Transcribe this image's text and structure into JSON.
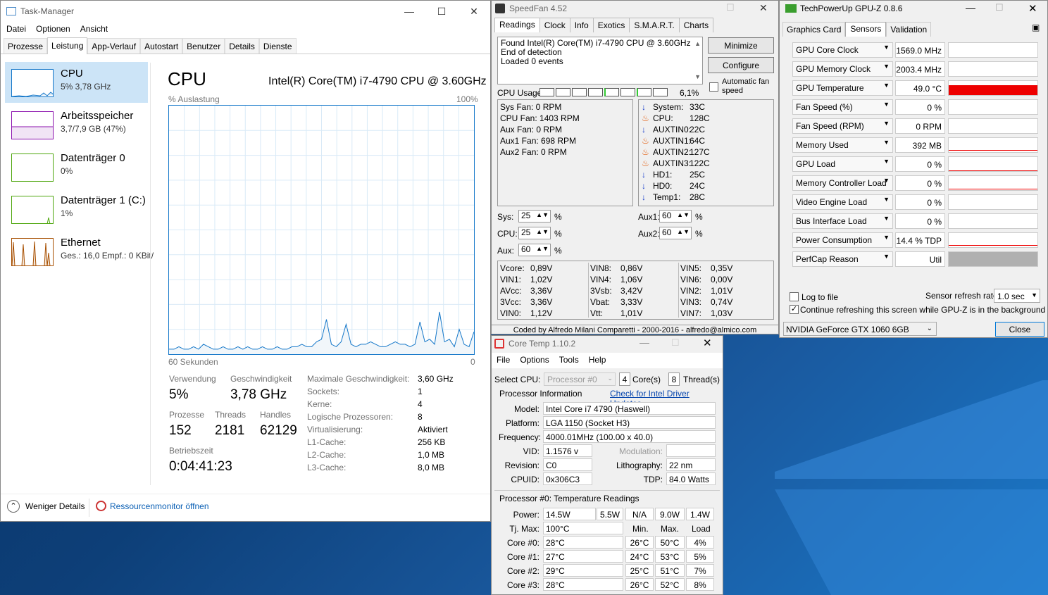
{
  "taskmanager": {
    "title": "Task-Manager",
    "menu": [
      "Datei",
      "Optionen",
      "Ansicht"
    ],
    "tabs": [
      "Prozesse",
      "Leistung",
      "App-Verlauf",
      "Autostart",
      "Benutzer",
      "Details",
      "Dienste"
    ],
    "active_tab": "Leistung",
    "side": [
      {
        "name": "CPU",
        "sub": "5% 3,78 GHz",
        "color": "#1477c9"
      },
      {
        "name": "Arbeitsspeicher",
        "sub": "3,7/7,9 GB (47%)",
        "color": "#8b12ae"
      },
      {
        "name": "Datenträger 0",
        "sub": "0%",
        "color": "#4da60c"
      },
      {
        "name": "Datenträger 1 (C:)",
        "sub": "1%",
        "color": "#4da60c"
      },
      {
        "name": "Ethernet",
        "sub": "Ges.: 16,0 Empf.: 0 KBit/",
        "color": "#a74f01"
      }
    ],
    "heading": "CPU",
    "model": "Intel(R) Core(TM) i7-4790 CPU @ 3.60GHz",
    "util_label": "% Auslastung",
    "util_max": "100%",
    "time_label": "60 Sekunden",
    "time_end": "0",
    "stats": {
      "verwendung_l": "Verwendung",
      "verwendung_v": "5%",
      "geschw_l": "Geschwindigkeit",
      "geschw_v": "3,78 GHz",
      "prozesse_l": "Prozesse",
      "prozesse_v": "152",
      "threads_l": "Threads",
      "threads_v": "2181",
      "handles_l": "Handles",
      "handles_v": "62129",
      "betrieb_l": "Betriebszeit",
      "betrieb_v": "0:04:41:23"
    },
    "details": [
      [
        "Maximale Geschwindigkeit:",
        "3,60 GHz"
      ],
      [
        "Sockets:",
        "1"
      ],
      [
        "Kerne:",
        "4"
      ],
      [
        "Logische Prozessoren:",
        "8"
      ],
      [
        "Virtualisierung:",
        "Aktiviert"
      ],
      [
        "L1-Cache:",
        "256 KB"
      ],
      [
        "L2-Cache:",
        "1,0 MB"
      ],
      [
        "L3-Cache:",
        "8,0 MB"
      ]
    ],
    "footer_less": "Weniger Details",
    "footer_monitor": "Ressourcenmonitor öffnen",
    "cpu_history": [
      2,
      2,
      3,
      2,
      2,
      3,
      2,
      4,
      3,
      2,
      2,
      3,
      2,
      2,
      3,
      2,
      3,
      2,
      2,
      3,
      2,
      2,
      3,
      2,
      2,
      3,
      3,
      4,
      3,
      3,
      5,
      6,
      14,
      4,
      3,
      5,
      12,
      4,
      3,
      4,
      4,
      5,
      4,
      3,
      3,
      4,
      5,
      4,
      4,
      3,
      4,
      13,
      5,
      6,
      4,
      17,
      5,
      6,
      3,
      10,
      4,
      3,
      9
    ]
  },
  "speedfan": {
    "title": "SpeedFan 4.52",
    "tabs": [
      "Readings",
      "Clock",
      "Info",
      "Exotics",
      "S.M.A.R.T.",
      "Charts"
    ],
    "log": [
      "Found Intel(R) Core(TM) i7-4790 CPU @ 3.60GHz",
      "End of detection",
      "Loaded 0 events"
    ],
    "minimize": "Minimize",
    "configure": "Configure",
    "auto_fan": "Automatic fan speed",
    "cpu_usage_label": "CPU Usage",
    "cpu_usage_val": "6,1%",
    "fans": [
      "Sys Fan:  0 RPM",
      "CPU Fan:  1403 RPM",
      "Aux Fan:  0 RPM",
      "Aux1 Fan: 698 RPM",
      "Aux2 Fan: 0 RPM"
    ],
    "temps": [
      {
        "n": "System:",
        "v": "33C",
        "hot": false
      },
      {
        "n": "CPU:",
        "v": "128C",
        "hot": true
      },
      {
        "n": "AUXTIN0:",
        "v": "22C",
        "hot": false
      },
      {
        "n": "AUXTIN1:",
        "v": "64C",
        "hot": true
      },
      {
        "n": "AUXTIN2:",
        "v": "127C",
        "hot": true
      },
      {
        "n": "AUXTIN3:",
        "v": "122C",
        "hot": true
      },
      {
        "n": "HD1:",
        "v": "25C",
        "hot": false
      },
      {
        "n": "HD0:",
        "v": "24C",
        "hot": false
      },
      {
        "n": "Temp1:",
        "v": "28C",
        "hot": false
      }
    ],
    "speeds": {
      "sys_l": "Sys:",
      "sys_v": "25",
      "cpu_l": "CPU:",
      "cpu_v": "25",
      "aux_l": "Aux:",
      "aux_v": "60",
      "aux1_l": "Aux1:",
      "aux1_v": "60",
      "aux2_l": "Aux2:",
      "aux2_v": "60",
      "pct": "%"
    },
    "volts": [
      [
        "Vcore:",
        "0,89V",
        "VIN8:",
        "0,86V",
        "VIN5:",
        "0,35V"
      ],
      [
        "VIN1:",
        "1,02V",
        "VIN4:",
        "1,06V",
        "VIN6:",
        "0,00V"
      ],
      [
        "AVcc:",
        "3,36V",
        "3Vsb:",
        "3,42V",
        "VIN2:",
        "1,01V"
      ],
      [
        "3Vcc:",
        "3,36V",
        "Vbat:",
        "3,33V",
        "VIN3:",
        "0,74V"
      ],
      [
        "VIN0:",
        "1,12V",
        "Vtt:",
        "1,01V",
        "VIN7:",
        "1,03V"
      ]
    ],
    "status": "Coded by Alfredo Milani Comparetti - 2000-2016 - alfredo@almico.com"
  },
  "gpuz": {
    "title": "TechPowerUp GPU-Z 0.8.6",
    "tabs": [
      "Graphics Card",
      "Sensors",
      "Validation"
    ],
    "sensors": [
      {
        "n": "GPU Core Clock",
        "v": "1569.0 MHz",
        "g": 0
      },
      {
        "n": "GPU Memory Clock",
        "v": "2003.4 MHz",
        "g": 0
      },
      {
        "n": "GPU Temperature",
        "v": "49.0 °C",
        "g": 0.7
      },
      {
        "n": "Fan Speed (%)",
        "v": "0 %",
        "g": 0
      },
      {
        "n": "Fan Speed (RPM)",
        "v": "0 RPM",
        "g": 0
      },
      {
        "n": "Memory Used",
        "v": "392 MB",
        "g": 0.1
      },
      {
        "n": "GPU Load",
        "v": "0 %",
        "g": 0.02
      },
      {
        "n": "Memory Controller Load",
        "v": "0 %",
        "g": 0.05
      },
      {
        "n": "Video Engine Load",
        "v": "0 %",
        "g": 0
      },
      {
        "n": "Bus Interface Load",
        "v": "0 %",
        "g": 0
      },
      {
        "n": "Power Consumption",
        "v": "14.4 % TDP",
        "g": 0.08
      },
      {
        "n": "PerfCap Reason",
        "v": "Util",
        "g": 1
      }
    ],
    "log_to_file": "Log to file",
    "refresh_label": "Sensor refresh rate:",
    "refresh_val": "1.0 sec",
    "continue": "Continue refreshing this screen while GPU-Z is in the background",
    "gpu": "NVIDIA GeForce GTX 1060 6GB",
    "close": "Close"
  },
  "coretemp": {
    "title": "Core Temp 1.10.2",
    "menu": [
      "File",
      "Options",
      "Tools",
      "Help"
    ],
    "select_cpu": "Select CPU:",
    "processor": "Processor #0",
    "cores": "4",
    "cores_l": "Core(s)",
    "threads": "8",
    "threads_l": "Thread(s)",
    "info_head": "Processor Information",
    "driver_link": "Check for Intel Driver Updates",
    "model_l": "Model:",
    "model_v": "Intel Core i7 4790 (Haswell)",
    "platform_l": "Platform:",
    "platform_v": "LGA 1150 (Socket H3)",
    "freq_l": "Frequency:",
    "freq_v": "4000.01MHz (100.00 x 40.0)",
    "vid_l": "VID:",
    "vid_v": "1.1576 v",
    "mod_l": "Modulation:",
    "rev_l": "Revision:",
    "rev_v": "C0",
    "litho_l": "Lithography:",
    "litho_v": "22 nm",
    "cpuid_l": "CPUID:",
    "cpuid_v": "0x306C3",
    "tdp_l": "TDP:",
    "tdp_v": "84.0 Watts",
    "temp_head": "Processor #0: Temperature Readings",
    "power_l": "Power:",
    "power": [
      "14.5W",
      "5.5W",
      "N/A",
      "9.0W",
      "1.4W"
    ],
    "tjmax_l": "Tj. Max:",
    "tjmax_v": "100°C",
    "col_min": "Min.",
    "col_max": "Max.",
    "col_load": "Load",
    "cores_rows": [
      [
        "Core #0:",
        "28°C",
        "26°C",
        "50°C",
        "4%"
      ],
      [
        "Core #1:",
        "27°C",
        "24°C",
        "53°C",
        "5%"
      ],
      [
        "Core #2:",
        "29°C",
        "25°C",
        "51°C",
        "7%"
      ],
      [
        "Core #3:",
        "28°C",
        "26°C",
        "52°C",
        "8%"
      ]
    ]
  }
}
